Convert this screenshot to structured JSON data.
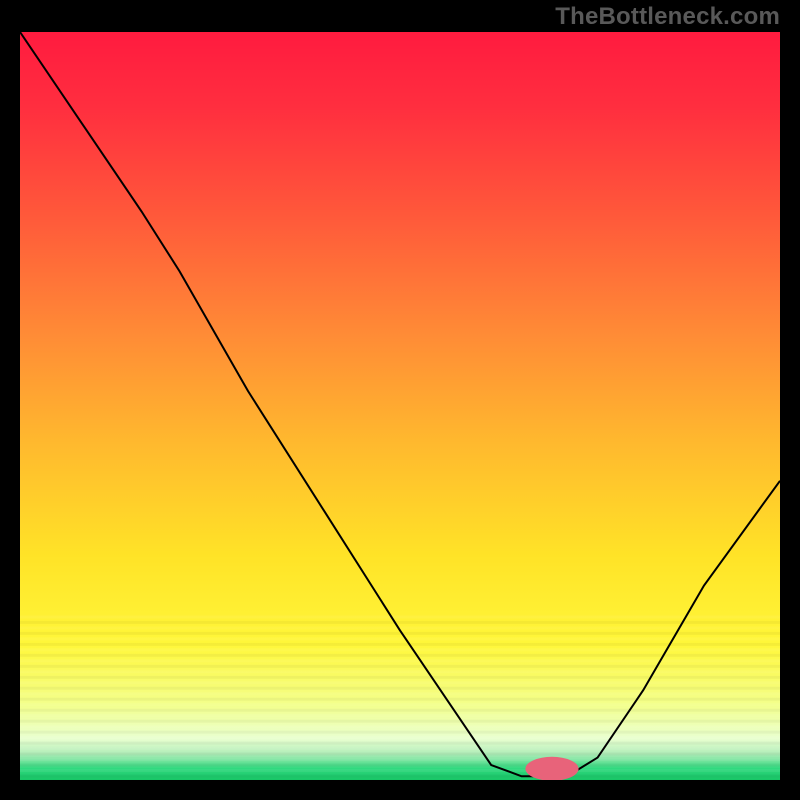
{
  "watermark": "TheBottleneck.com",
  "chart_data": {
    "type": "line",
    "title": "",
    "xlabel": "",
    "ylabel": "",
    "xlim": [
      0,
      100
    ],
    "ylim": [
      0,
      100
    ],
    "grid": false,
    "legend": false,
    "curve": {
      "stroke": "#000000",
      "width": 2,
      "points": [
        {
          "x": 0,
          "y": 100
        },
        {
          "x": 8,
          "y": 88
        },
        {
          "x": 16,
          "y": 76
        },
        {
          "x": 21,
          "y": 68
        },
        {
          "x": 30,
          "y": 52
        },
        {
          "x": 40,
          "y": 36
        },
        {
          "x": 50,
          "y": 20
        },
        {
          "x": 58,
          "y": 8
        },
        {
          "x": 62,
          "y": 2
        },
        {
          "x": 66,
          "y": 0.5
        },
        {
          "x": 72,
          "y": 0.5
        },
        {
          "x": 76,
          "y": 3
        },
        {
          "x": 82,
          "y": 12
        },
        {
          "x": 90,
          "y": 26
        },
        {
          "x": 100,
          "y": 40
        }
      ]
    },
    "marker": {
      "x": 70,
      "y": 1.5,
      "rx": 3.5,
      "ry": 1.6,
      "fill": "#e8637a"
    },
    "background_gradient": {
      "stops": [
        {
          "offset": 0.0,
          "color": "#ff1b3f"
        },
        {
          "offset": 0.1,
          "color": "#ff2e3f"
        },
        {
          "offset": 0.25,
          "color": "#ff5a3a"
        },
        {
          "offset": 0.4,
          "color": "#ff8a36"
        },
        {
          "offset": 0.55,
          "color": "#ffb92e"
        },
        {
          "offset": 0.7,
          "color": "#ffe327"
        },
        {
          "offset": 0.82,
          "color": "#fff73a"
        },
        {
          "offset": 0.9,
          "color": "#f3ff8d"
        },
        {
          "offset": 0.945,
          "color": "#e9ffd0"
        },
        {
          "offset": 0.965,
          "color": "#b0edb8"
        },
        {
          "offset": 0.985,
          "color": "#2fd97e"
        },
        {
          "offset": 1.0,
          "color": "#18c566"
        }
      ],
      "banding_start": 0.78
    }
  }
}
